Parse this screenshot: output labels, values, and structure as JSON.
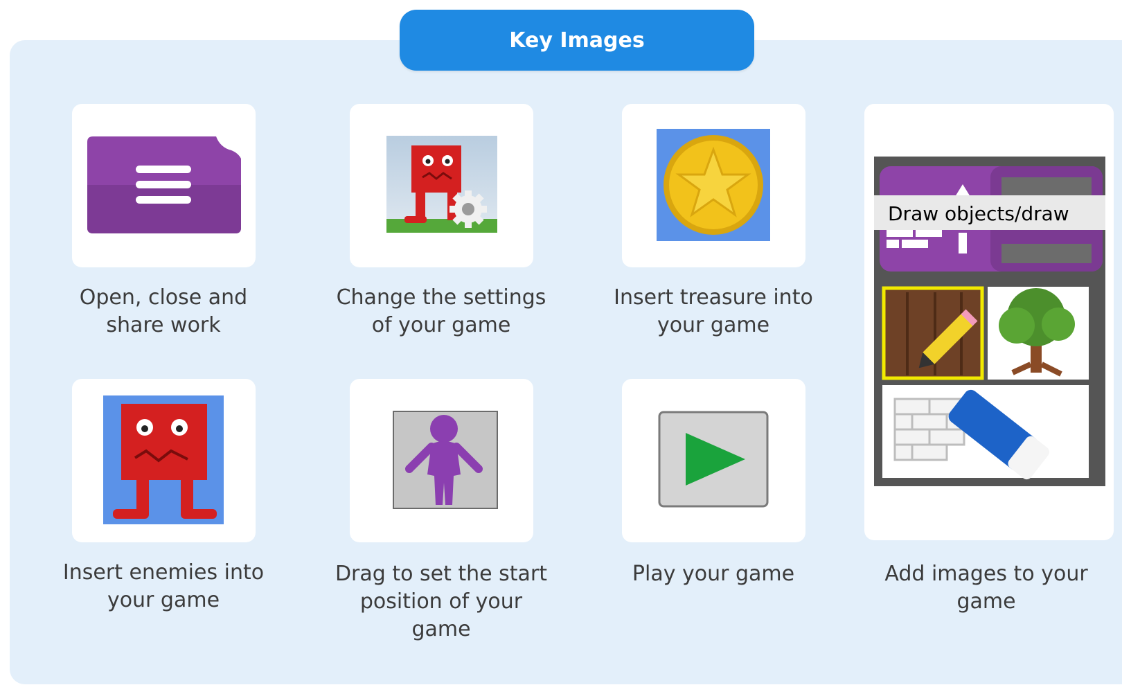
{
  "title": "Key Images",
  "items": [
    {
      "label": "Open, close and\nshare work",
      "icon": "menu-icon"
    },
    {
      "label": "Change the settings\nof your game",
      "icon": "settings-monster-icon"
    },
    {
      "label": "Insert treasure into\nyour game",
      "icon": "treasure-coin-icon"
    },
    {
      "label": "Add images to your\ngame",
      "icon": "draw-objects-icon"
    },
    {
      "label": "Insert enemies into\nyour game",
      "icon": "enemy-monster-icon"
    },
    {
      "label": "Drag to set the start\nposition of your\ngame",
      "icon": "start-position-icon"
    },
    {
      "label": "Play your game",
      "icon": "play-icon"
    }
  ],
  "draw_tooltip": "Draw objects/draw",
  "colors": {
    "accent": "#1f8ae3",
    "panel": "#e3effa",
    "purple": "#8e44a8",
    "monster_red": "#d42020",
    "play_green": "#1aa33c",
    "coin_gold": "#f2c21b"
  }
}
